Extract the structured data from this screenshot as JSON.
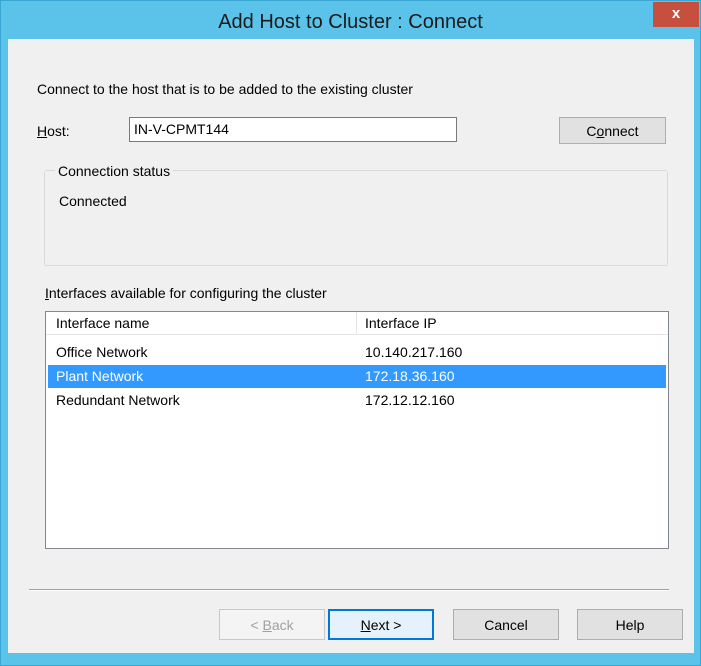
{
  "window": {
    "title": "Add Host to Cluster : Connect",
    "close_label": "x"
  },
  "intro_text": "Connect to the host that is to be added to the existing cluster",
  "host": {
    "label_accel": "H",
    "label_rest": "ost:",
    "value": "IN-V-CPMT144"
  },
  "connect_button": {
    "pre": "C",
    "accel": "o",
    "post": "nnect"
  },
  "connection_status": {
    "legend": "Connection status",
    "value": "Connected"
  },
  "interfaces": {
    "label_accel": "I",
    "label_rest": "nterfaces available for configuring the cluster",
    "columns": [
      "Interface name",
      "Interface IP"
    ],
    "rows": [
      {
        "name": "Office Network",
        "ip": "10.140.217.160",
        "selected": false
      },
      {
        "name": "Plant Network",
        "ip": "172.18.36.160",
        "selected": true
      },
      {
        "name": "Redundant Network",
        "ip": "172.12.12.160",
        "selected": false
      }
    ]
  },
  "footer": {
    "back": {
      "pre": "< ",
      "accel": "B",
      "post": "ack"
    },
    "next": {
      "pre": "",
      "accel": "N",
      "post": "ext >"
    },
    "cancel": "Cancel",
    "help": "Help"
  },
  "colors": {
    "titlebar": "#5bc3ea",
    "close": "#c74f3d",
    "selection": "#3399ff"
  }
}
